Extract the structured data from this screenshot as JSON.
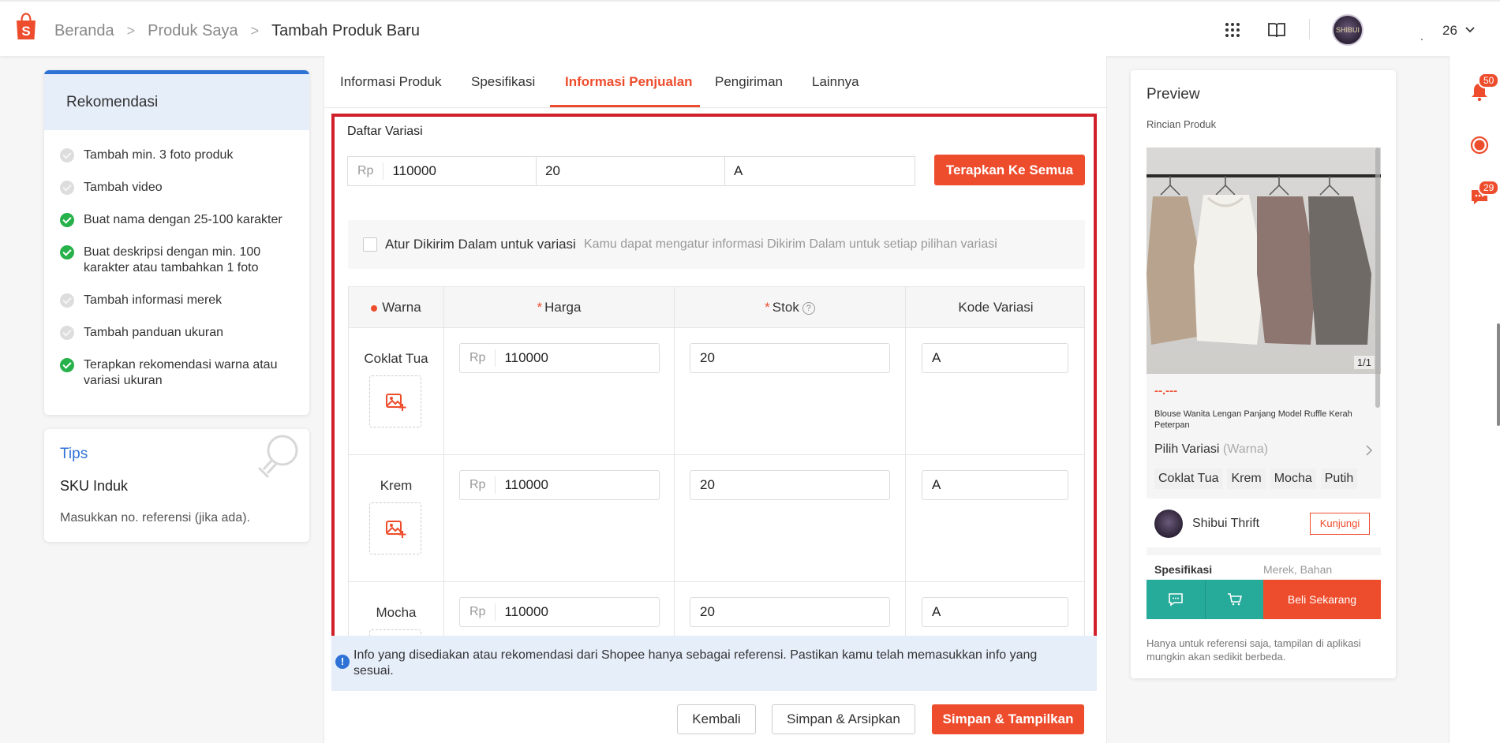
{
  "header": {
    "breadcrumbs": [
      "Beranda",
      "Produk Saya",
      "Tambah Produk Baru"
    ],
    "user_dot": ".",
    "user_number": "26",
    "avatar_text": "SHIBUI"
  },
  "sidebar": {
    "rekomendasi_title": "Rekomendasi",
    "items": [
      {
        "label": "Tambah min. 3 foto produk",
        "done": false
      },
      {
        "label": "Tambah video",
        "done": false
      },
      {
        "label": "Buat nama dengan 25-100 karakter",
        "done": true
      },
      {
        "label": "Buat deskripsi dengan min. 100 karakter atau tambahkan 1 foto",
        "done": true
      },
      {
        "label": "Tambah informasi merek",
        "done": false
      },
      {
        "label": "Tambah panduan ukuran",
        "done": false
      },
      {
        "label": "Terapkan rekomendasi warna atau variasi ukuran",
        "done": true
      }
    ],
    "tips": {
      "title": "Tips",
      "heading": "SKU Induk",
      "text": "Masukkan no. referensi (jika ada)."
    }
  },
  "tabs": [
    "Informasi Produk",
    "Spesifikasi",
    "Informasi Penjualan",
    "Pengiriman",
    "Lainnya"
  ],
  "active_tab": "Informasi Penjualan",
  "variasi": {
    "title": "Daftar Variasi",
    "currency": "Rp",
    "bulk_price": "110000",
    "bulk_stock": "20",
    "bulk_code": "A",
    "apply_all_label": "Terapkan Ke Semua",
    "ship_label": "Atur Dikirim Dalam untuk variasi",
    "ship_hint": "Kamu dapat mengatur informasi Dikirim Dalam untuk setiap pilihan variasi",
    "columns": {
      "warna": "Warna",
      "harga": "Harga",
      "stok": "Stok",
      "stok_help": "?",
      "kode": "Kode Variasi",
      "required_mark": "*"
    },
    "rows": [
      {
        "name": "Coklat Tua",
        "price": "110000",
        "stock": "20",
        "code": "A"
      },
      {
        "name": "Krem",
        "price": "110000",
        "stock": "20",
        "code": "A"
      },
      {
        "name": "Mocha",
        "price": "110000",
        "stock": "20",
        "code": "A"
      }
    ]
  },
  "info_bar": {
    "icon": "!",
    "text": "Info yang disediakan atau rekomendasi dari Shopee hanya sebagai referensi. Pastikan kamu telah memasukkan info yang sesuai."
  },
  "footer_buttons": {
    "back": "Kembali",
    "save_archive": "Simpan & Arsipkan",
    "save_show": "Simpan & Tampilkan"
  },
  "preview": {
    "title": "Preview",
    "subtitle": "Rincian Produk",
    "photo_count": "1/1",
    "price": "--.---",
    "product_name": "Blouse Wanita Lengan Panjang Model Ruffle Kerah Peterpan",
    "pilih_label": "Pilih Variasi",
    "pilih_sub": "(Warna)",
    "chips": [
      "Coklat Tua",
      "Krem",
      "Mocha",
      "Putih"
    ],
    "shop_name": "Shibui Thrift",
    "visit_label": "Kunjungi",
    "spec_label": "Spesifikasi",
    "spec_value": "Merek, Bahan",
    "buy_label": "Beli Sekarang",
    "note": "Hanya untuk referensi saja, tampilan di aplikasi mungkin akan sedikit berbeda."
  },
  "rail": {
    "notif_count": "50",
    "chat_count": "29"
  },
  "colors": {
    "accent": "#ee4d2d",
    "blue": "#2f72d6",
    "green": "#26b14a",
    "teal": "#26aa99",
    "highlight": "#d0202a"
  }
}
